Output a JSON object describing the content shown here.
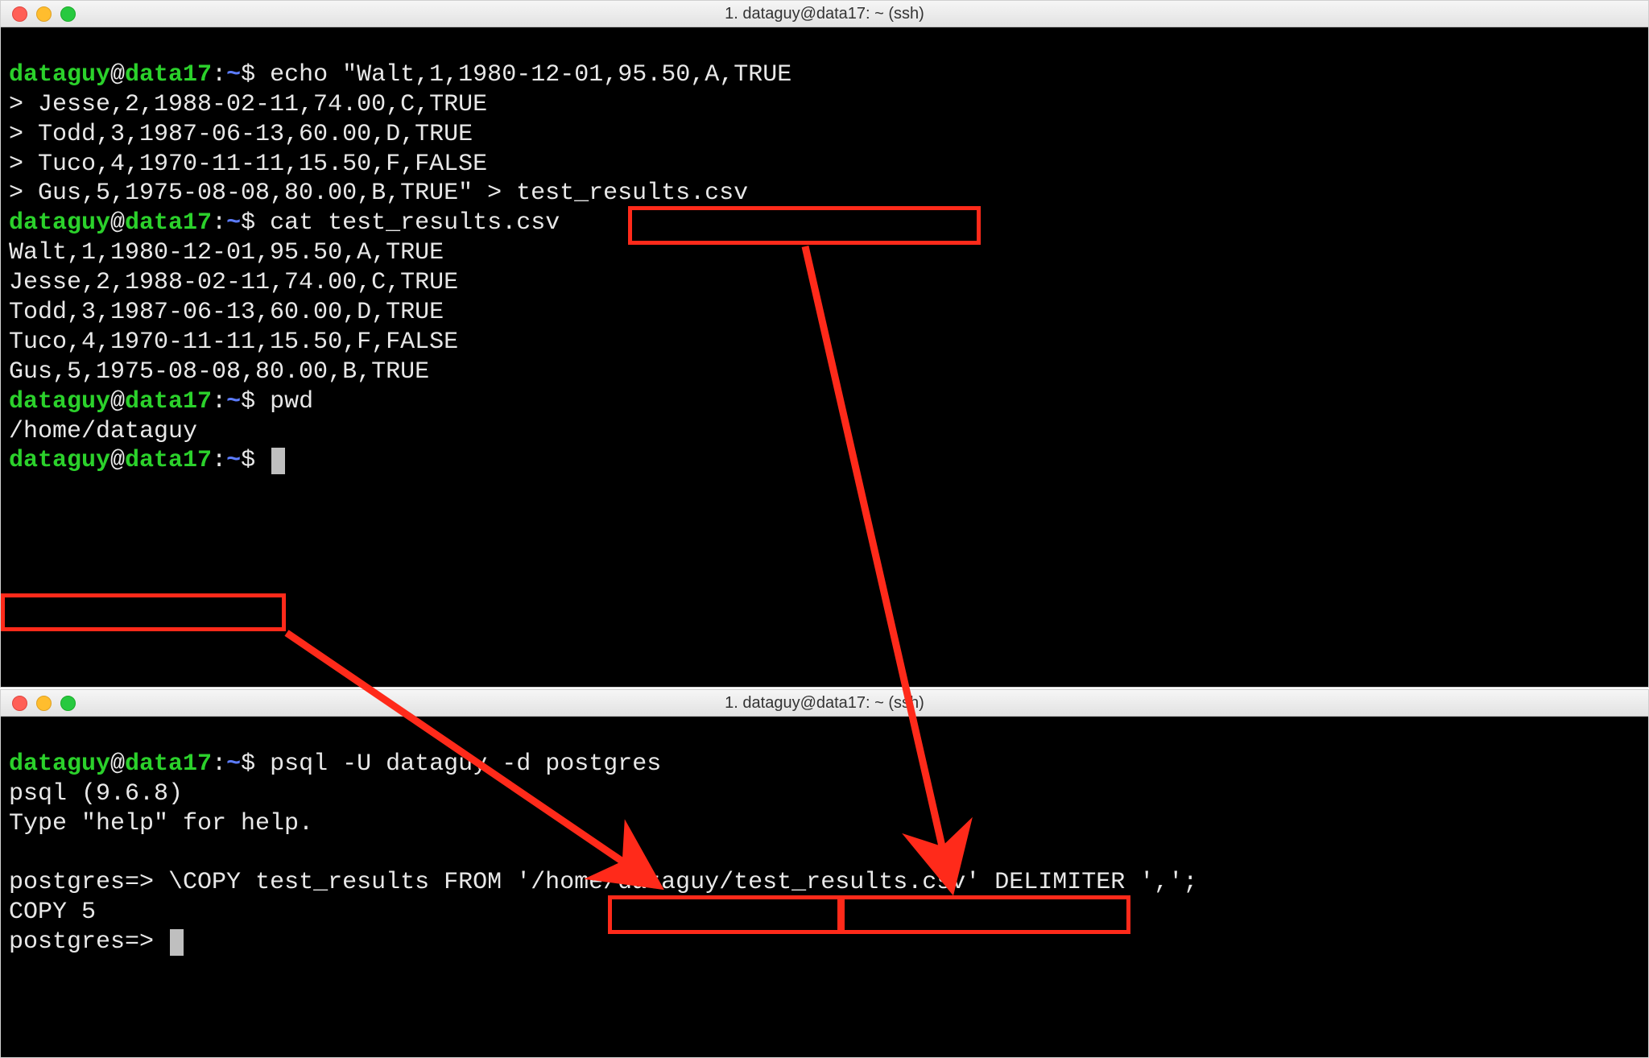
{
  "window_top": {
    "title": "1. dataguy@data17: ~ (ssh)",
    "prompt_user": "dataguy",
    "prompt_host": "data17",
    "prompt_path": "~",
    "cmd_echo_head": "echo \"Walt,1,1980-12-01,95.50,A,TRUE",
    "echo_lines": [
      "> Jesse,2,1988-02-11,74.00,C,TRUE",
      "> Todd,3,1987-06-13,60.00,D,TRUE",
      "> Tuco,4,1970-11-11,15.50,F,FALSE"
    ],
    "echo_tail_prefix": "> Gus,5,1975-08-08,80.00,B,TRUE\" > ",
    "echo_tail_file": "test_results.csv",
    "cmd_cat": "cat test_results.csv",
    "cat_output": [
      "Walt,1,1980-12-01,95.50,A,TRUE",
      "Jesse,2,1988-02-11,74.00,C,TRUE",
      "Todd,3,1987-06-13,60.00,D,TRUE",
      "Tuco,4,1970-11-11,15.50,F,FALSE",
      "Gus,5,1975-08-08,80.00,B,TRUE"
    ],
    "cmd_pwd": "pwd",
    "pwd_output": "/home/dataguy"
  },
  "window_bottom": {
    "title": "1. dataguy@data17: ~ (ssh)",
    "prompt_user": "dataguy",
    "prompt_host": "data17",
    "prompt_path": "~",
    "cmd_psql": "psql -U dataguy -d postgres",
    "psql_version": "psql (9.6.8)",
    "psql_hint": "Type \"help\" for help.",
    "psql_blank": "",
    "psql_prompt1": "postgres=> ",
    "copy_pre": "\\COPY test_results FROM ",
    "copy_path_a": "'/home/dataguy/",
    "copy_path_b": "test_results.csv'",
    "copy_tail": " DELIMITER ',';",
    "copy_result": "COPY 5",
    "psql_prompt2": "postgres=> "
  },
  "glyphs": {
    "at": "@",
    "colon": ":",
    "dollar": "$"
  }
}
